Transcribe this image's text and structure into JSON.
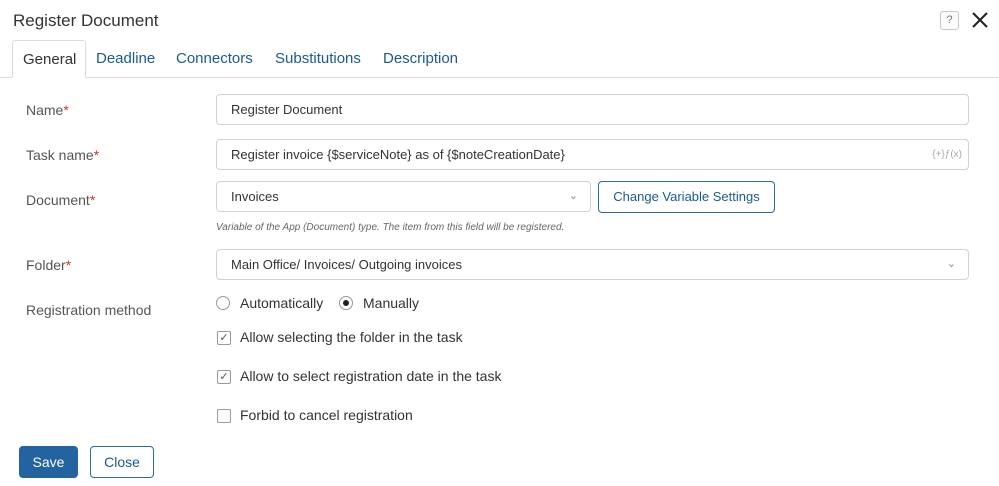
{
  "dialog": {
    "title": "Register Document",
    "help_glyph": "?"
  },
  "tabs": [
    {
      "label": "General"
    },
    {
      "label": "Deadline"
    },
    {
      "label": "Connectors"
    },
    {
      "label": "Substitutions"
    },
    {
      "label": "Description"
    }
  ],
  "form": {
    "name": {
      "label": "Name",
      "required_mark": "*",
      "value": "Register Document"
    },
    "task_name": {
      "label": "Task name",
      "required_mark": "*",
      "value": "Register invoice {$serviceNote} as of {$noteCreationDate}",
      "fx_glyph": "{+}ƒ(x)"
    },
    "document": {
      "label": "Document",
      "required_mark": "*",
      "value": "Invoices",
      "hint": "Variable of the App (Document) type. The item from this field will be registered.",
      "settings_button": "Change Variable Settings"
    },
    "folder": {
      "label": "Folder",
      "required_mark": "*",
      "value": "Main Office/ Invoices/ Outgoing invoices"
    },
    "registration": {
      "label": "Registration method",
      "options": [
        {
          "label": "Automatically",
          "selected": false
        },
        {
          "label": "Manually",
          "selected": true
        }
      ],
      "checkboxes": [
        {
          "label": "Allow selecting the folder in the task",
          "checked": true,
          "mark": "✓"
        },
        {
          "label": "Allow to select registration date in the task",
          "checked": true,
          "mark": "✓"
        },
        {
          "label": "Forbid to cancel registration",
          "checked": false,
          "mark": ""
        }
      ]
    }
  },
  "footer": {
    "save_label": "Save",
    "close_label": "Close"
  },
  "colors": {
    "accent": "#2263a0",
    "link": "#1a5a94",
    "required": "#d0342c"
  }
}
